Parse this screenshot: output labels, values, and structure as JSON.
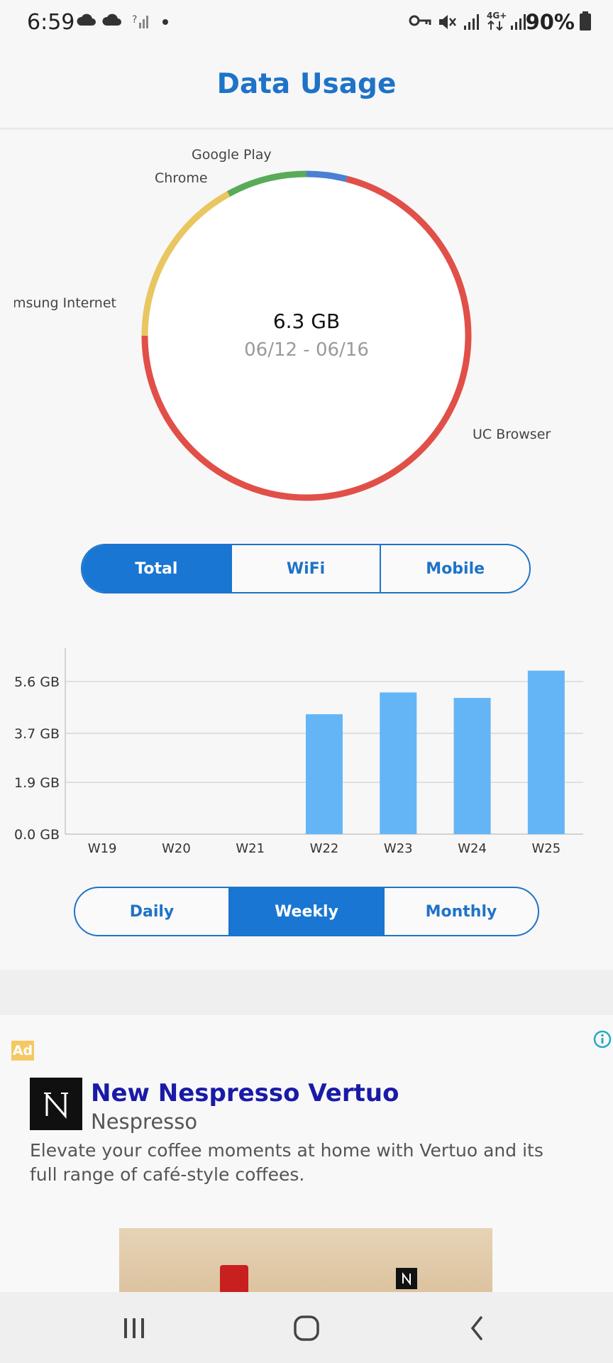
{
  "status_bar": {
    "time": "6:59",
    "battery": "90%",
    "network": "4G+"
  },
  "header": {
    "title": "Data Usage"
  },
  "donut": {
    "total": "6.3 GB",
    "date_range": "06/12 - 06/16",
    "segments": [
      {
        "label": "Google Play",
        "fraction": 0.04,
        "color": "#4a7fd4"
      },
      {
        "label": "UC Browser",
        "fraction": 0.71,
        "color": "#e05048"
      },
      {
        "label": "Samsung Internet",
        "fraction": 0.17,
        "color": "#e8c660"
      },
      {
        "label": "Chrome",
        "fraction": 0.08,
        "color": "#5aab59"
      }
    ]
  },
  "filter_tabs": [
    {
      "label": "Total",
      "active": true
    },
    {
      "label": "WiFi",
      "active": false
    },
    {
      "label": "Mobile",
      "active": false
    }
  ],
  "chart_data": {
    "type": "bar",
    "categories": [
      "W19",
      "W20",
      "W21",
      "W22",
      "W23",
      "W24",
      "W25"
    ],
    "values": [
      0,
      0,
      0,
      4.4,
      5.2,
      5.0,
      6.0
    ],
    "y_ticks": [
      "0.0 GB",
      "1.9 GB",
      "3.7 GB",
      "5.6 GB"
    ],
    "y_tick_values": [
      0,
      1.9,
      3.7,
      5.6
    ],
    "ylim": [
      0,
      6.8
    ],
    "grid": true,
    "bar_color": "#64b5f6"
  },
  "period_tabs": [
    {
      "label": "Daily",
      "active": false
    },
    {
      "label": "Weekly",
      "active": true
    },
    {
      "label": "Monthly",
      "active": false
    }
  ],
  "ad": {
    "badge": "Ad",
    "logo_letter": "N",
    "title": "New Nespresso Vertuo",
    "advertiser": "Nespresso",
    "description": "Elevate your coffee moments at home with Vertuo and its full range of café-style coffees."
  }
}
